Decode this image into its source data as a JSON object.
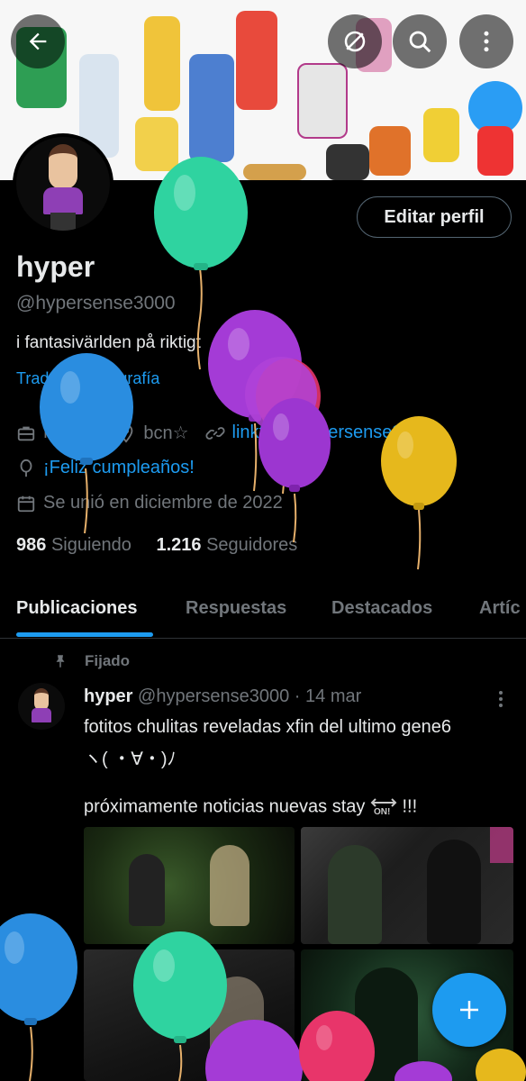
{
  "profile": {
    "name": "hyper",
    "handle": "@hypersense3000",
    "bio": "i fantasivärlden på riktigt",
    "translate_bio": "Traducir la biografía",
    "edit_button": "Editar perfil",
    "category": "Músico",
    "location": "bcn☆",
    "link": "linktr.ee/hypersense3000",
    "birthday": "¡Feliz cumpleaños!",
    "joined": "Se unió en diciembre de 2022",
    "following_count": "986",
    "following_label": "Siguiendo",
    "followers_count": "1.216",
    "followers_label": "Seguidores"
  },
  "tabs": [
    "Publicaciones",
    "Respuestas",
    "Destacados",
    "Artíc"
  ],
  "pinned_label": "Fijado",
  "tweet": {
    "name": "hyper",
    "handle": "@hypersense3000",
    "sep": "·",
    "date": "14 mar",
    "line1": "fotitos chulitas reveladas xfin del ultimo gene6",
    "line2": "ヽ( ・∀・)ﾉ",
    "line3": "próximamente noticias nuevas stay",
    "line3_end": "!!!",
    "on_badge": "ON!"
  },
  "icons": {
    "back": "back-arrow-icon",
    "no_edit": "slashed-circle-icon",
    "search": "search-icon",
    "more": "more-vertical-icon",
    "fab": "plus-icon"
  },
  "colors": {
    "accent": "#1d9bf0",
    "muted": "#71767b",
    "text": "#e7e9ea",
    "background": "#000000",
    "balloon_green": "#2fd3a0",
    "balloon_purple": "#a43bd6",
    "balloon_blue": "#2a8de0",
    "balloon_yellow": "#e6b81c",
    "balloon_pink": "#e8356a"
  }
}
